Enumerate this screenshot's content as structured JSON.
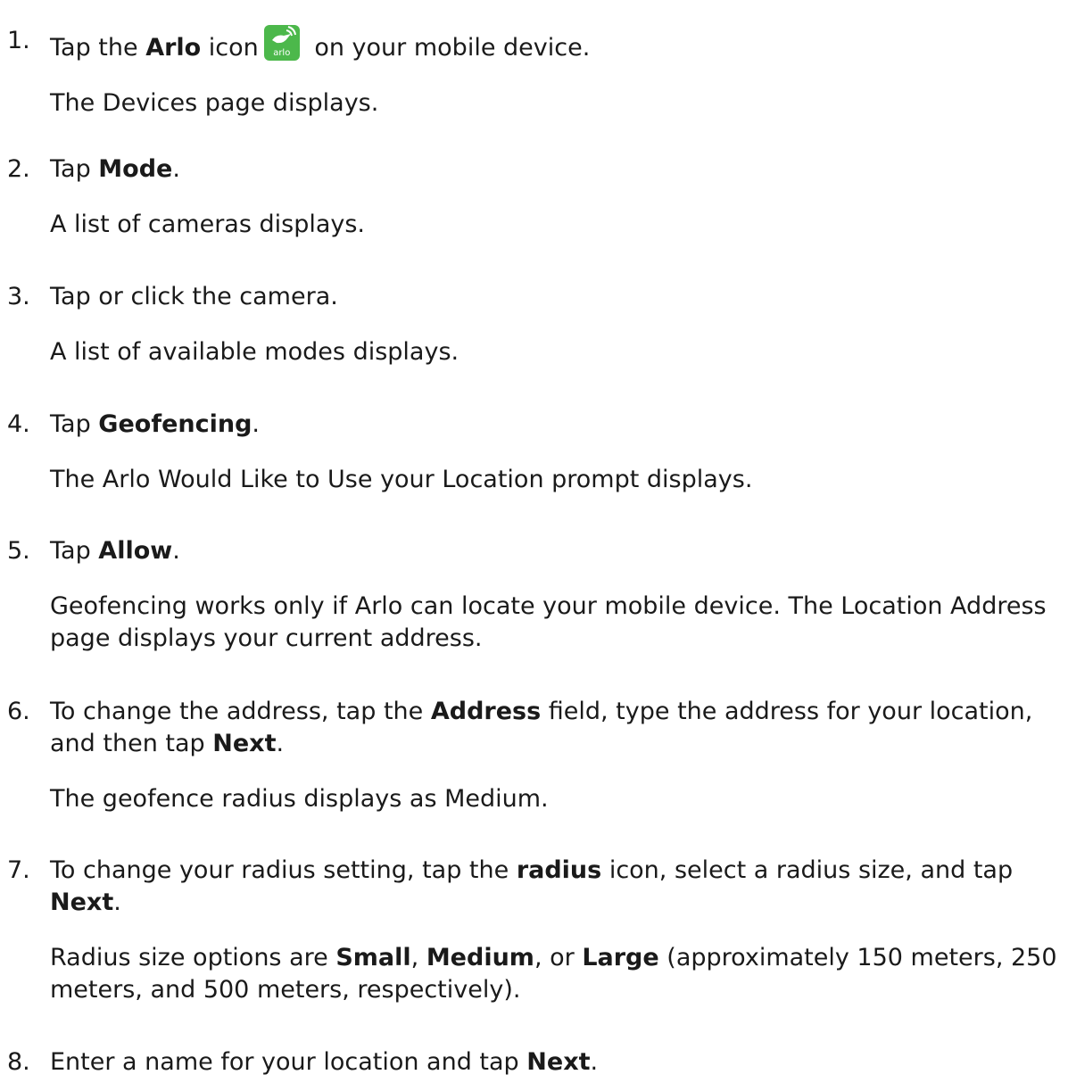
{
  "steps": [
    {
      "number": "1.",
      "parts": [
        "Tap the ",
        "Arlo",
        " icon",
        " on your mobile device."
      ],
      "result": "The Devices page displays."
    },
    {
      "number": "2.",
      "parts": [
        "Tap ",
        "Mode",
        "."
      ],
      "result": "A list of cameras displays."
    },
    {
      "number": "3.",
      "text": "Tap or click the camera.",
      "result": "A list of available modes displays."
    },
    {
      "number": "4.",
      "parts": [
        "Tap ",
        "Geofencing",
        "."
      ],
      "result": "The Arlo Would Like to Use your Location prompt displays."
    },
    {
      "number": "5.",
      "parts": [
        "Tap ",
        "Allow",
        "."
      ],
      "result": "Geofencing works only if Arlo can locate your mobile device. The Location Address page displays your current address."
    },
    {
      "number": "6.",
      "parts": [
        "To change the address, tap the ",
        "Address",
        " field, type the address for your location, and then tap ",
        "Next",
        "."
      ],
      "result": "The geofence radius displays as Medium."
    },
    {
      "number": "7.",
      "parts": [
        "To change your radius setting, tap the ",
        "radius",
        " icon, select a radius size, and tap ",
        "Next",
        "."
      ],
      "result_parts": [
        "Radius size options are ",
        "Small",
        ", ",
        "Medium",
        ", or ",
        "Large",
        " (approximately 150 meters, 250 meters, and 500 meters, respectively)."
      ]
    },
    {
      "number": "8.",
      "parts": [
        "Enter a name for your location and tap ",
        "Next",
        "."
      ]
    }
  ],
  "icons": {
    "arlo_app_icon": {
      "name": "arlo-app-icon",
      "label": "arlo",
      "color": "#4cb84b"
    }
  }
}
